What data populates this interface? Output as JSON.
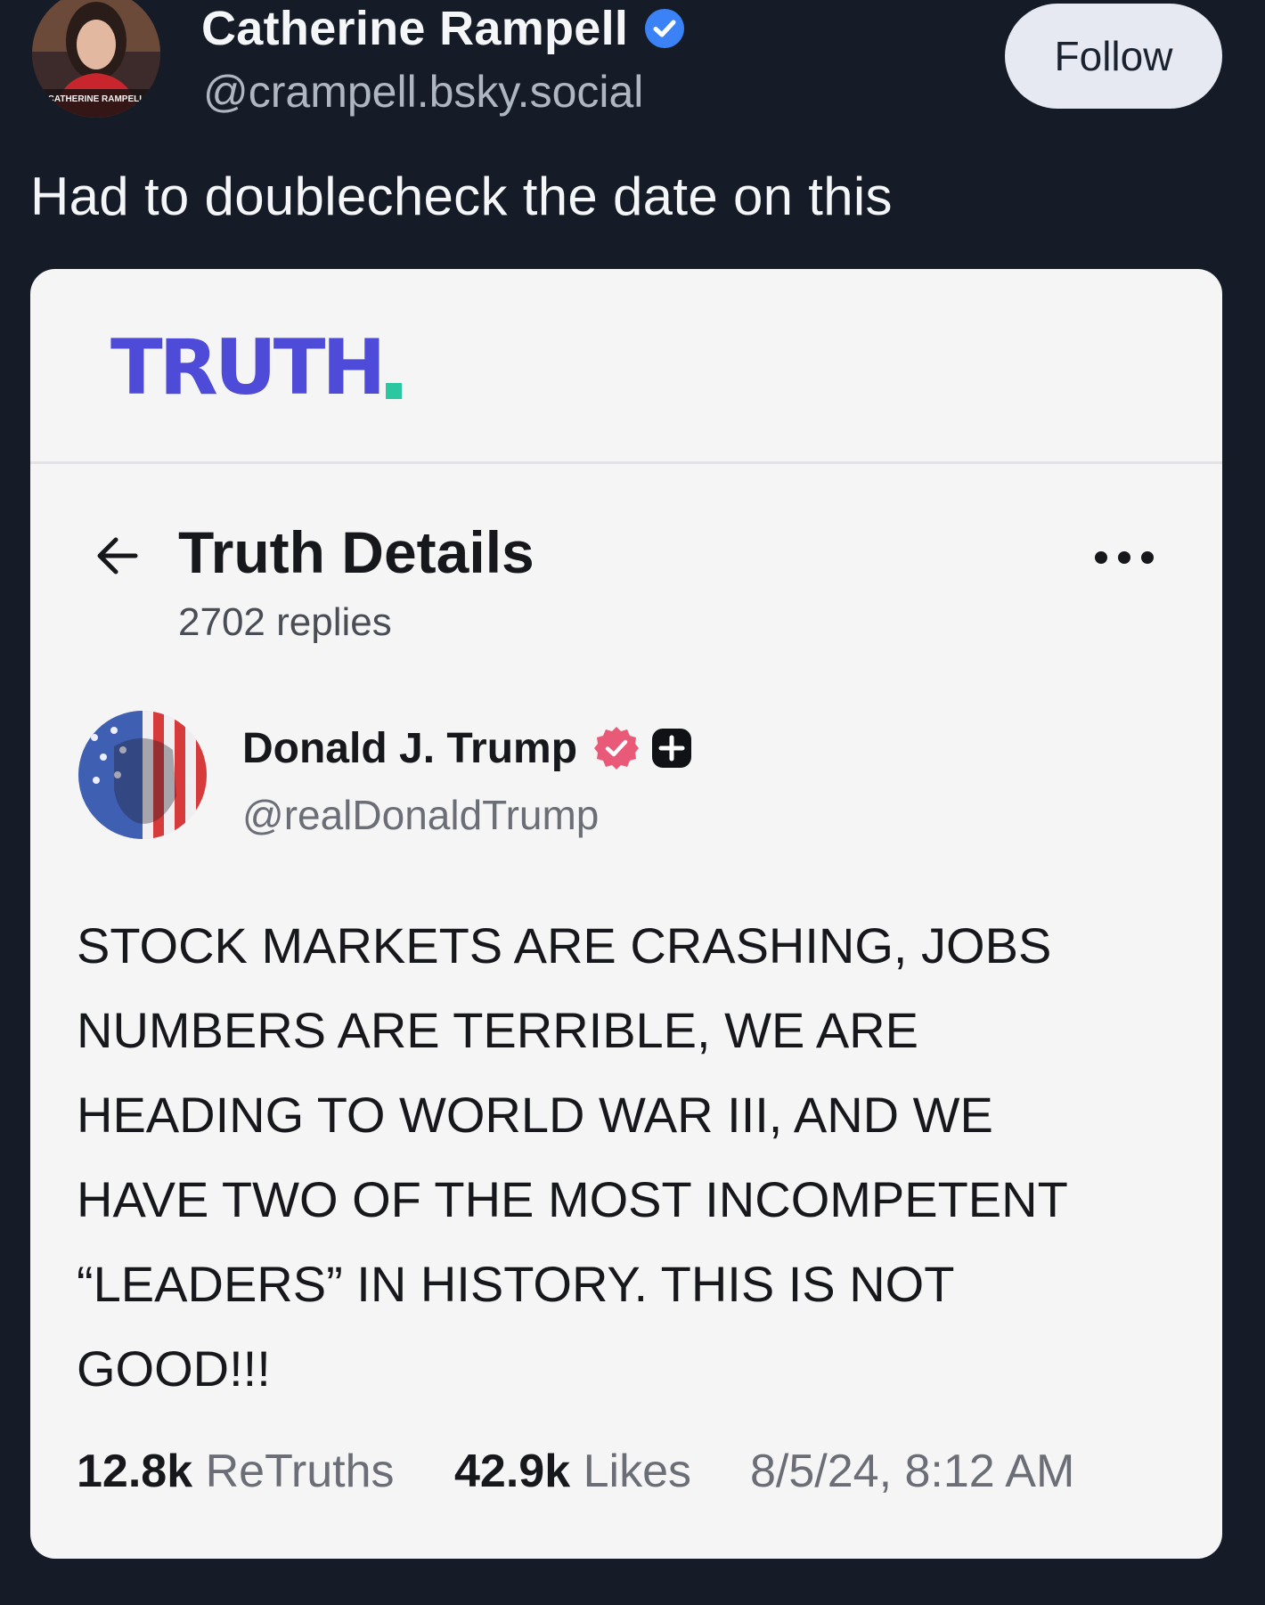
{
  "outer_post": {
    "author_name": "Catherine Rampell",
    "author_handle": "@crampell.bsky.social",
    "follow_label": "Follow",
    "text": "Had to doublecheck the date on this",
    "avatar_caption": "CATHERINE RAMPELL",
    "verified_icon": "verified-check-icon",
    "accent_color": "#3b82f6"
  },
  "embedded": {
    "logo_text": "TRUTH",
    "logo_color": "#4f4bd9",
    "logo_dot_color": "#2bc7a0",
    "header": {
      "title": "Truth Details",
      "replies": "2702 replies"
    },
    "author": {
      "name": "Donald J. Trump",
      "handle": "@realDonaldTrump"
    },
    "body_lines": [
      "STOCK MARKETS ARE CRASHING, JOBS",
      "NUMBERS ARE TERRIBLE, WE ARE",
      "HEADING TO WORLD WAR III, AND WE",
      "HAVE TWO OF THE MOST INCOMPETENT",
      "“LEADERS” IN HISTORY. THIS IS NOT",
      "GOOD!!!"
    ],
    "stats": {
      "retruths_count": "12.8k",
      "retruths_label": "ReTruths",
      "likes_count": "42.9k",
      "likes_label": "Likes",
      "timestamp": "8/5/24, 8:12 AM"
    }
  }
}
